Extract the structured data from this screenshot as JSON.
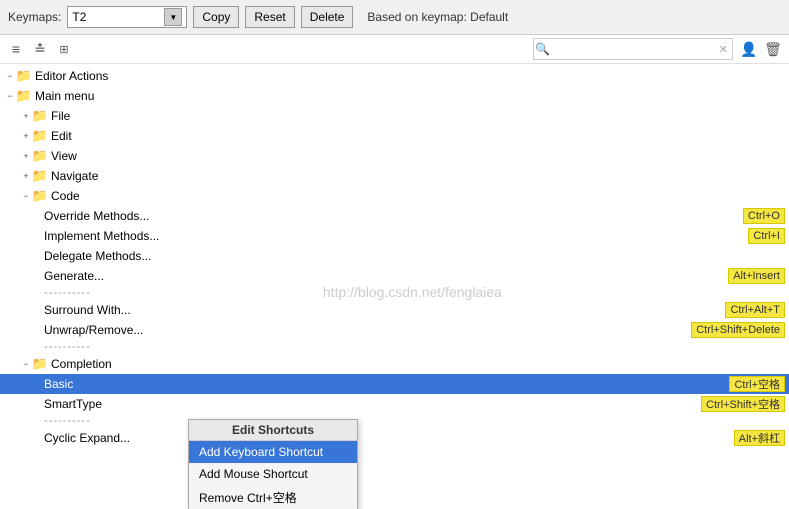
{
  "topBar": {
    "keymapLabel": "Keymaps:",
    "keymapValue": "T2",
    "copyBtn": "Copy",
    "resetBtn": "Reset",
    "deleteBtn": "Delete",
    "basedOn": "Based on keymap: Default"
  },
  "toolbar": {
    "icon1": "≡",
    "icon2": "≢",
    "icon3": "⊞",
    "searchPlaceholder": "",
    "searchIcon": "🔍",
    "userIcon": "👤",
    "deleteIcon": "🗑"
  },
  "tree": {
    "items": [
      {
        "id": "editor-actions",
        "label": "Editor Actions",
        "indent": 0,
        "expand": "-",
        "hasFolder": true,
        "shortcut": ""
      },
      {
        "id": "main-menu",
        "label": "Main menu",
        "indent": 0,
        "expand": "-",
        "hasFolder": true,
        "shortcut": ""
      },
      {
        "id": "file",
        "label": "File",
        "indent": 1,
        "expand": "+",
        "hasFolder": true,
        "shortcut": ""
      },
      {
        "id": "edit",
        "label": "Edit",
        "indent": 1,
        "expand": "+",
        "hasFolder": true,
        "shortcut": ""
      },
      {
        "id": "view",
        "label": "View",
        "indent": 1,
        "expand": "+",
        "hasFolder": true,
        "shortcut": ""
      },
      {
        "id": "navigate",
        "label": "Navigate",
        "indent": 1,
        "expand": "+",
        "hasFolder": true,
        "shortcut": ""
      },
      {
        "id": "code",
        "label": "Code",
        "indent": 1,
        "expand": "-",
        "hasFolder": true,
        "shortcut": ""
      },
      {
        "id": "override",
        "label": "Override Methods...",
        "indent": 2,
        "expand": "",
        "hasFolder": false,
        "shortcut": "Ctrl+O"
      },
      {
        "id": "implement",
        "label": "Implement Methods...",
        "indent": 2,
        "expand": "",
        "hasFolder": false,
        "shortcut": "Ctrl+I"
      },
      {
        "id": "delegate",
        "label": "Delegate Methods...",
        "indent": 2,
        "expand": "",
        "hasFolder": false,
        "shortcut": ""
      },
      {
        "id": "generate",
        "label": "Generate...",
        "indent": 2,
        "expand": "",
        "hasFolder": false,
        "shortcut": "Alt+Insert"
      },
      {
        "id": "sep1",
        "label": "----------",
        "indent": 2,
        "expand": "",
        "hasFolder": false,
        "shortcut": "",
        "isSep": true
      },
      {
        "id": "surround",
        "label": "Surround With...",
        "indent": 2,
        "expand": "",
        "hasFolder": false,
        "shortcut": "Ctrl+Alt+T"
      },
      {
        "id": "unwrap",
        "label": "Unwrap/Remove...",
        "indent": 2,
        "expand": "",
        "hasFolder": false,
        "shortcut": "Ctrl+Shift+Delete"
      },
      {
        "id": "sep2",
        "label": "----------",
        "indent": 2,
        "expand": "",
        "hasFolder": false,
        "shortcut": "",
        "isSep": true
      },
      {
        "id": "completion",
        "label": "Completion",
        "indent": 1,
        "expand": "-",
        "hasFolder": true,
        "shortcut": ""
      },
      {
        "id": "basic",
        "label": "Basic",
        "indent": 2,
        "expand": "",
        "hasFolder": false,
        "shortcut": "Ctrl+空格",
        "selected": true
      },
      {
        "id": "smarttype",
        "label": "SmartType",
        "indent": 2,
        "expand": "",
        "hasFolder": false,
        "shortcut": "Ctrl+Shift+空格"
      },
      {
        "id": "sep3",
        "label": "----------",
        "indent": 2,
        "expand": "",
        "hasFolder": false,
        "shortcut": "",
        "isSep": true
      },
      {
        "id": "cyclicexpand",
        "label": "Cyclic Expand...",
        "indent": 2,
        "expand": "",
        "hasFolder": false,
        "shortcut": "Alt+斜杠"
      }
    ]
  },
  "contextMenu": {
    "header": "Edit Shortcuts",
    "items": [
      {
        "id": "add-keyboard",
        "label": "Add Keyboard Shortcut",
        "active": true
      },
      {
        "id": "add-mouse",
        "label": "Add Mouse Shortcut",
        "active": false
      },
      {
        "id": "remove",
        "label": "Remove Ctrl+空格",
        "active": false
      }
    ]
  },
  "watermark": "http://blog.csdn.net/fenglaiea"
}
